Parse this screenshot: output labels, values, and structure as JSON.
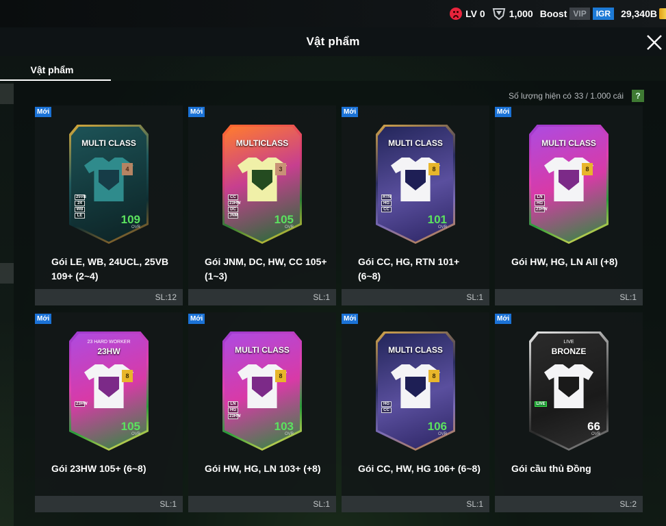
{
  "status": {
    "level": "LV 0",
    "points": "1,000",
    "boost_label": "Boost",
    "vip_label": "VIP",
    "igr_label": "IGR",
    "balance": "29,340B"
  },
  "header": {
    "title": "Vật phẩm"
  },
  "tabs": [
    {
      "label": "Vật phẩm"
    }
  ],
  "stock": {
    "label": "Số lượng hiện có",
    "value": "33 / 1.000 cái",
    "help": "?"
  },
  "items": [
    {
      "badge": "Mới",
      "card_title": "MULTI CLASS",
      "card_sub": "",
      "grade": "4",
      "positions": [
        "25VB",
        "24",
        "WB",
        "LE"
      ],
      "ovr": "109",
      "ovr_label": "OVR",
      "name": "Gói LE, WB, 24UCL, 25VB 109+ (2~4)",
      "qty": "SL:12"
    },
    {
      "badge": "Mới",
      "card_title": "MULTICLASS",
      "card_sub": "",
      "grade": "3",
      "positions": [
        "CC",
        "23HW",
        "DC",
        "JNM"
      ],
      "ovr": "105",
      "ovr_label": "OVR",
      "name": "Gói JNM, DC, HW, CC 105+ (1~3)",
      "qty": "SL:1"
    },
    {
      "badge": "Mới",
      "card_title": "MULTI CLASS",
      "card_sub": "",
      "grade": "8",
      "positions": [
        "RTN",
        "HG",
        "CC"
      ],
      "ovr": "101",
      "ovr_label": "OVR",
      "name": "Gói CC, HG, RTN 101+ (6~8)",
      "qty": "SL:1"
    },
    {
      "badge": "Mới",
      "card_title": "MULTI CLASS",
      "card_sub": "",
      "grade": "8",
      "positions": [
        "LN",
        "HG",
        "23HW"
      ],
      "ovr": "",
      "ovr_label": "",
      "name": "Gói HW, HG, LN All (+8)",
      "qty": "SL:1"
    },
    {
      "badge": "Mới",
      "card_title": "23HW",
      "card_sub": "23 HARD WORKER",
      "grade": "8",
      "positions": [
        "23HW"
      ],
      "ovr": "105",
      "ovr_label": "OVR",
      "name": "Gói 23HW 105+ (6~8)",
      "qty": "SL:1"
    },
    {
      "badge": "Mới",
      "card_title": "MULTI CLASS",
      "card_sub": "",
      "grade": "8",
      "positions": [
        "LN",
        "HG",
        "23HW"
      ],
      "ovr": "103",
      "ovr_label": "OVR",
      "name": "Gói HW, HG, LN 103+ (+8)",
      "qty": "SL:1"
    },
    {
      "badge": "Mới",
      "card_title": "MULTI CLASS",
      "card_sub": "",
      "grade": "8",
      "positions": [
        "HG",
        "CC"
      ],
      "ovr": "106",
      "ovr_label": "OVR",
      "name": "Gói CC, HW, HG 106+ (6~8)",
      "qty": "SL:1"
    },
    {
      "badge": "Mới",
      "card_title": "BRONZE",
      "card_sub": "LIVE",
      "grade": "",
      "positions": [
        "LIVE"
      ],
      "ovr": "66",
      "ovr_label": "OVR",
      "name": "Gói cầu thủ Đồng",
      "qty": "SL:2"
    }
  ],
  "colors": {
    "accent_green": "#3ce34a",
    "new_badge": "#1b72d6",
    "igr": "#1d7ad6",
    "level_icon": "#e8243c"
  }
}
